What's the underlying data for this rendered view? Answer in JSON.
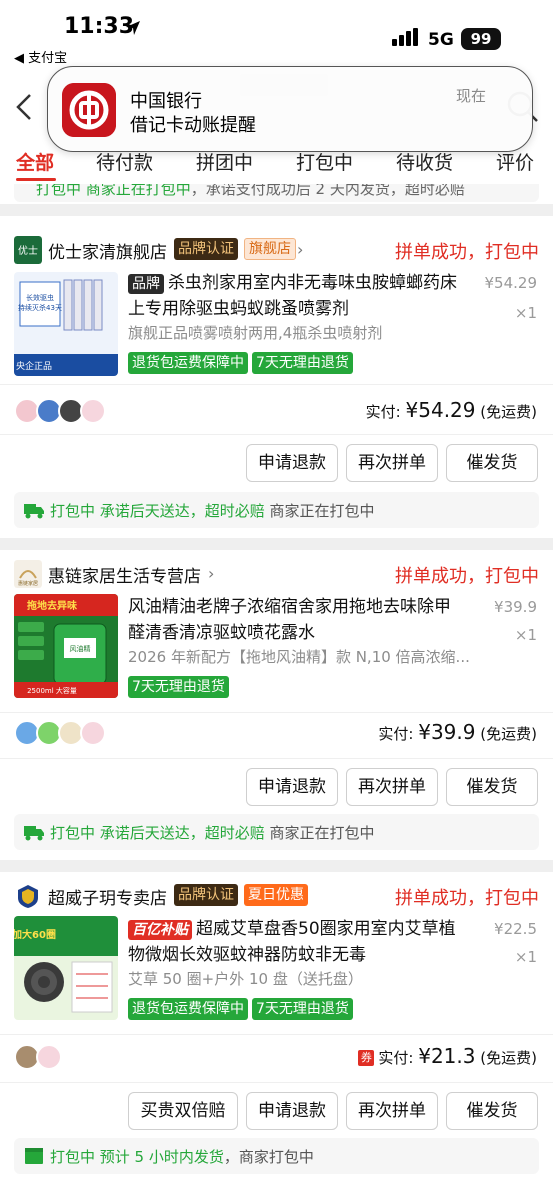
{
  "status_bar": {
    "time": "11:33",
    "back_app": "◀ 支付宝",
    "network": "5G",
    "battery": "99"
  },
  "notification": {
    "app": "中国银行",
    "message": "借记卡动账提醒",
    "time": "现在"
  },
  "tabs": [
    {
      "label": "全部",
      "active": true
    },
    {
      "label": "待付款"
    },
    {
      "label": "拼团中"
    },
    {
      "label": "打包中"
    },
    {
      "label": "待收货"
    },
    {
      "label": "评价"
    }
  ],
  "top_strip": {
    "status": "打包中 商家正在打包中",
    "text": "，承诺支付成功后 2 天内发货，超时必赔"
  },
  "orders": [
    {
      "shop_name": "优士家清旗舰店",
      "badges": [
        "品牌认证",
        "旗舰店"
      ],
      "status": "拼单成功，打包中",
      "title_tag": "品牌",
      "title": "杀虫剂家用室内非无毒味虫胺蟑螂药床上专用除驱虫蚂蚁跳蚤喷雾剂",
      "subtitle": "旗舰正品喷雾喷射两用,4瓶杀虫喷射剂",
      "price_orig": "¥54.29",
      "qty": "×1",
      "service_tags": [
        "退货包运费保障中",
        "7天无理由退货"
      ],
      "paid_label": "实付:",
      "paid_amount": "¥54.29",
      "paid_note": "(免运费)",
      "buttons": [
        "申请退款",
        "再次拼单",
        "催发货"
      ],
      "ship_status": "打包中 承诺后天送达，超时必赔",
      "ship_note": " 商家正在打包中"
    },
    {
      "shop_name": "惠链家居生活专营店",
      "badges": [],
      "status": "拼单成功，打包中",
      "title": "风油精油老牌子浓缩宿舍家用拖地去味除甲醛清香清凉驱蚊喷花露水",
      "subtitle": "2026 年新配方【拖地风油精】款 N,10 倍高浓缩...",
      "price_orig": "¥39.9",
      "qty": "×1",
      "service_tags": [
        "7天无理由退货"
      ],
      "thumb_text": "拖地去异味",
      "thumb_bottom": "2500ml 大容量",
      "paid_label": "实付:",
      "paid_amount": "¥39.9",
      "paid_note": "(免运费)",
      "buttons": [
        "申请退款",
        "再次拼单",
        "催发货"
      ],
      "ship_status": "打包中 承诺后天送达，超时必赔",
      "ship_note": " 商家正在打包中"
    },
    {
      "shop_name": "超威子玥专卖店",
      "badges": [
        "品牌认证",
        "夏日优惠"
      ],
      "status": "拼单成功，打包中",
      "title_tag": "百亿补贴",
      "title": "超威艾草盘香50圈家用室内艾草植物微烟长效驱蚊神器防蚊非无毒",
      "subtitle": "艾草 50 圈+户外 10 盘（送托盘）",
      "price_orig": "¥22.5",
      "qty": "×1",
      "service_tags": [
        "退货包运费保障中",
        "7天无理由退货"
      ],
      "thumb_text": "加大60圈",
      "paid_label": "实付:",
      "paid_amount": "¥21.3",
      "paid_note": "(免运费)",
      "coupon": "券",
      "buttons": [
        "买贵双倍赔",
        "申请退款",
        "再次拼单",
        "催发货"
      ],
      "ship_status": "打包中 预计 5 小时内发货",
      "ship_note": "，商家打包中"
    }
  ],
  "colors": {
    "accent": "#e02e24",
    "green": "#25a73a"
  }
}
